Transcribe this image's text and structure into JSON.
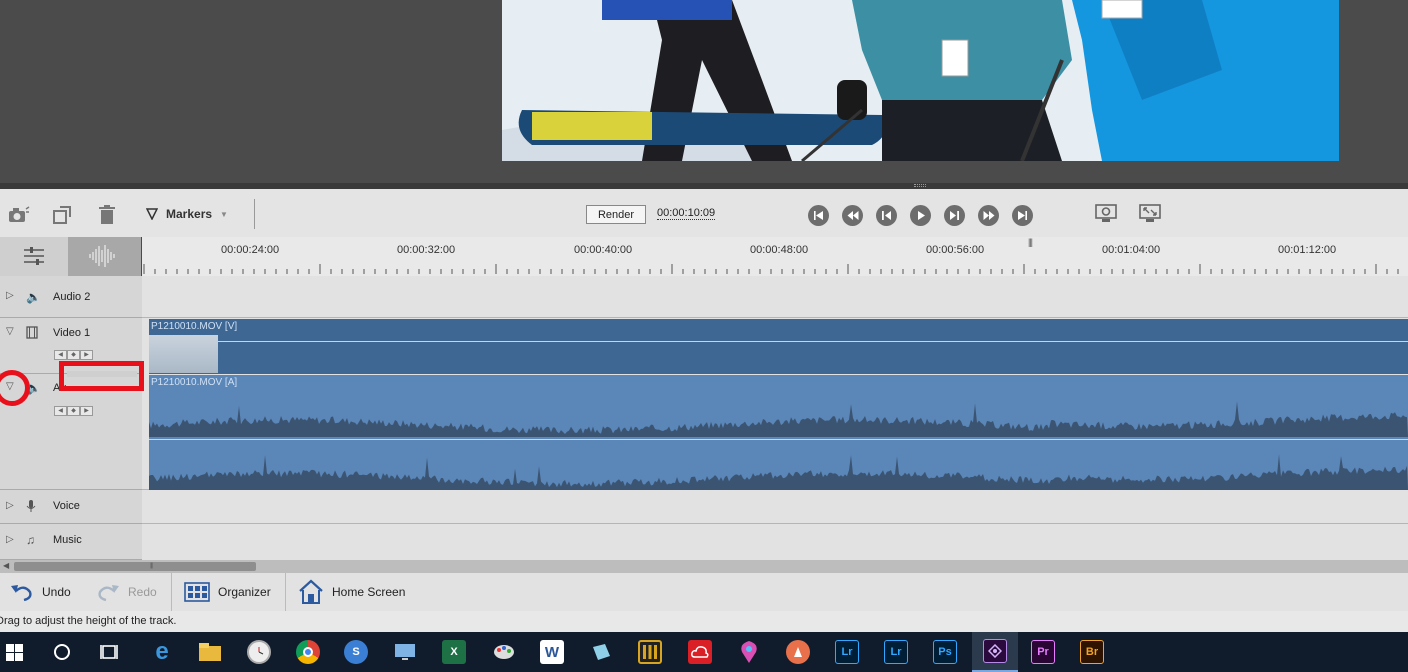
{
  "toolbar": {
    "markers_label": "Markers",
    "render_label": "Render",
    "timecode": "00:00:10:09"
  },
  "ruler": {
    "ticks": [
      "00:00:24:00",
      "00:00:32:00",
      "00:00:40:00",
      "00:00:48:00",
      "00:00:56:00",
      "00:01:04:00",
      "00:01:12:00"
    ]
  },
  "tracks": {
    "audio2": "Audio 2",
    "video1": "Video 1",
    "audio1": "Au",
    "voice": "Voice",
    "music": "Music"
  },
  "clips": {
    "video": "P1210010.MOV [V]",
    "audio": "P1210010.MOV [A]"
  },
  "bottom": {
    "undo": "Undo",
    "redo": "Redo",
    "organizer": "Organizer",
    "home": "Home Screen"
  },
  "status": {
    "text": "Drag to adjust the height of the track."
  },
  "taskbar": {
    "apps": [
      "start",
      "cortana",
      "task-view",
      "edge",
      "explorer",
      "clock",
      "chrome",
      "app-s",
      "remote",
      "excel",
      "paint",
      "word",
      "app-box",
      "marker",
      "creative-cloud",
      "maps",
      "app-pen",
      "lightroom",
      "lightroom-classic",
      "photoshop",
      "premiere-elements",
      "premiere-pro",
      "bridge"
    ],
    "labels": {
      "lr1": "Lr",
      "lr2": "Lr",
      "ps": "Ps",
      "pr": "Pr",
      "br": "Br",
      "word": "W",
      "excel": "X"
    }
  },
  "colors": {
    "clip_video": "#3e6794",
    "clip_audio": "#5b86b8",
    "waveform": "#3b5472",
    "annotation": "#e8101a"
  }
}
